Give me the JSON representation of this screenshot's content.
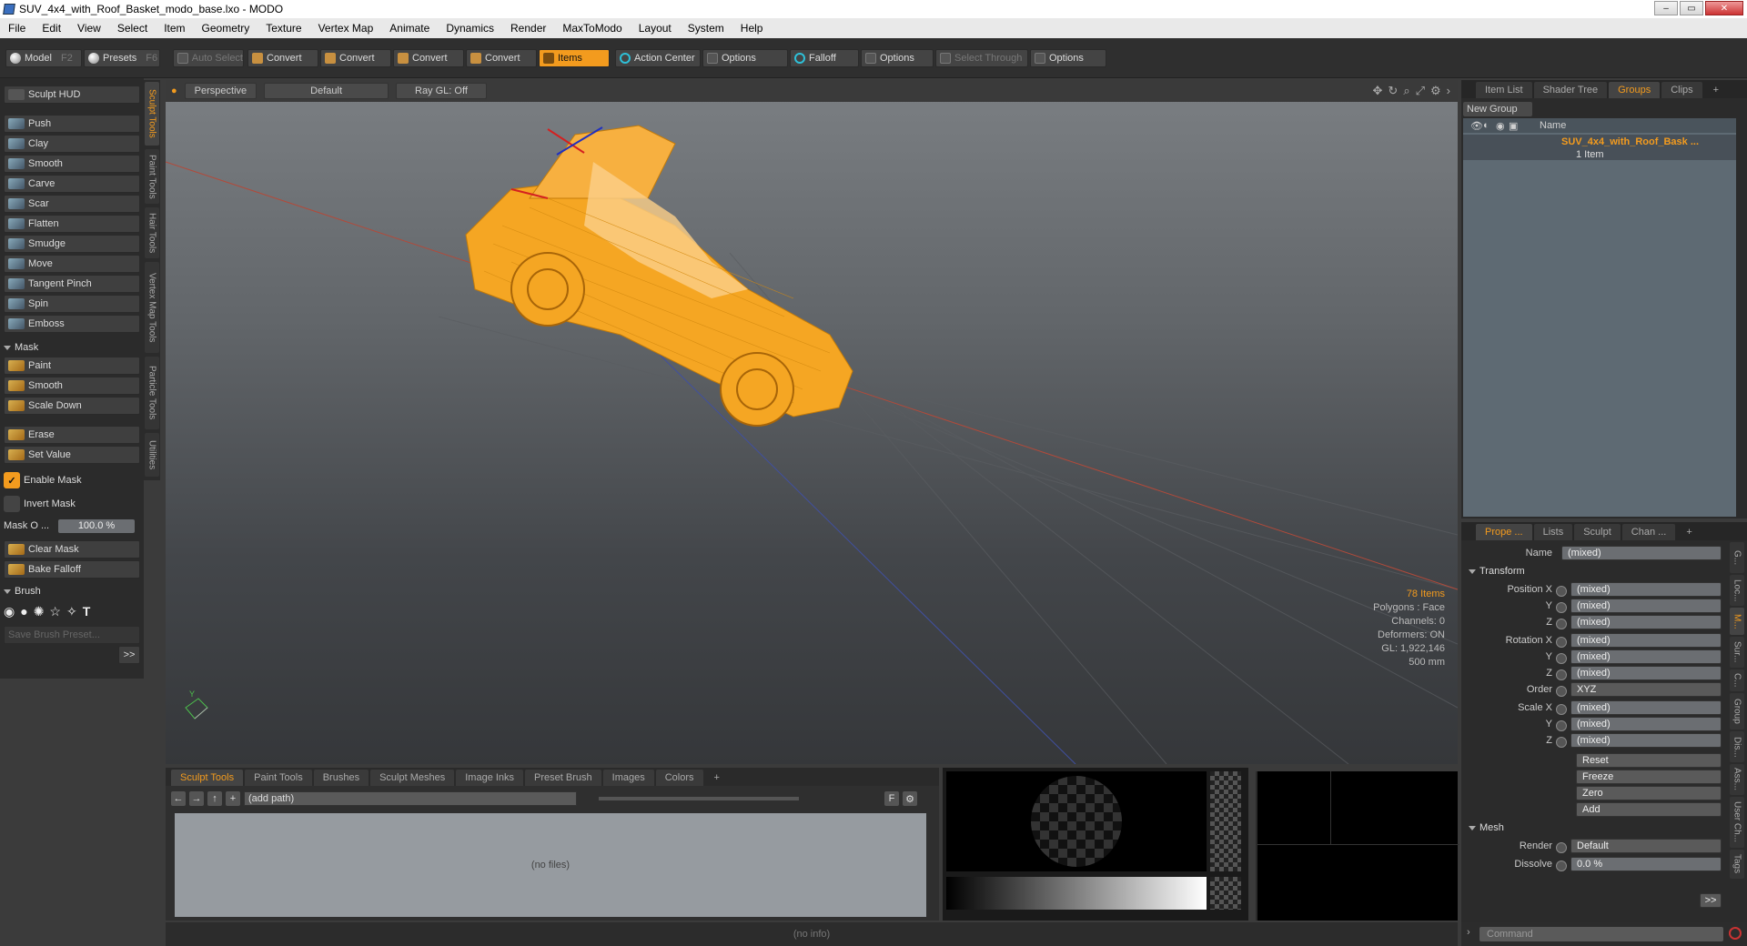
{
  "window": {
    "title": "SUV_4x4_with_Roof_Basket_modo_base.lxo - MODO",
    "buttons": [
      "–",
      "▭",
      "✕"
    ]
  },
  "menu": [
    "File",
    "Edit",
    "View",
    "Select",
    "Item",
    "Geometry",
    "Texture",
    "Vertex Map",
    "Animate",
    "Dynamics",
    "Render",
    "MaxToModo",
    "Layout",
    "System",
    "Help"
  ],
  "toolbar": {
    "model": "Model",
    "model_key": "F2",
    "presets": "Presets",
    "presets_key": "F6",
    "auto_select": "Auto Select",
    "convert": "Convert",
    "items": "Items",
    "action_center": "Action Center",
    "options": "Options",
    "falloff": "Falloff",
    "select_through": "Select Through"
  },
  "left": {
    "sculpt_hud": "Sculpt HUD",
    "tools": [
      "Push",
      "Clay",
      "Smooth",
      "Carve",
      "Scar",
      "Flatten",
      "Smudge",
      "Move",
      "Tangent Pinch",
      "Spin",
      "Emboss"
    ],
    "mask_header": "Mask",
    "mask_tools": [
      "Paint",
      "Smooth",
      "Scale Down"
    ],
    "erase": "Erase",
    "set_value": "Set Value",
    "enable_mask": "Enable Mask",
    "invert_mask": "Invert Mask",
    "mask_opacity_label": "Mask O ...",
    "mask_opacity_value": "100.0 %",
    "clear_mask": "Clear Mask",
    "bake_falloff": "Bake Falloff",
    "brush_header": "Brush",
    "save_brush": "Save Brush Preset...",
    "more": ">>"
  },
  "vtabs": [
    "Sculpt Tools",
    "Paint Tools",
    "Hair Tools",
    "Vertex Map Tools",
    "Particle Tools",
    "Utilities"
  ],
  "viewport": {
    "view": "Perspective",
    "shading": "Default",
    "raygl": "Ray GL: Off",
    "stats": {
      "items": "78 Items",
      "polygons": "Polygons : Face",
      "channels": "Channels: 0",
      "deformers": "Deformers: ON",
      "gl": "GL: 1,922,146",
      "scale": "500 mm"
    },
    "axis_y": "Y"
  },
  "bottom": {
    "tabs": [
      "Sculpt Tools",
      "Paint Tools",
      "Brushes",
      "Sculpt Meshes",
      "Image Inks",
      "Preset Brush",
      "Images",
      "Colors",
      "+"
    ],
    "path": "(add path)",
    "nofiles": "(no files)",
    "f": "F"
  },
  "status": "(no info)",
  "groups": {
    "tabs": [
      "Item List",
      "Shader Tree",
      "Groups",
      "Clips",
      "+"
    ],
    "new_group": "New Group",
    "name_col": "Name",
    "item_name": "SUV_4x4_with_Roof_Bask ...",
    "item_count": "1 Item"
  },
  "props": {
    "tabs": [
      "Prope ...",
      "Lists",
      "Sculpt",
      "Chan ...",
      "+"
    ],
    "name_label": "Name",
    "name_value": "(mixed)",
    "transform": "Transform",
    "position_label": "Position X",
    "rotation_label": "Rotation X",
    "scale_label": "Scale X",
    "y": "Y",
    "z": "Z",
    "mixed": "(mixed)",
    "order_label": "Order",
    "order_value": "XYZ",
    "reset": "Reset",
    "freeze": "Freeze",
    "zero": "Zero",
    "add": "Add",
    "mesh": "Mesh",
    "render_label": "Render",
    "render_value": "Default",
    "dissolve_label": "Dissolve",
    "dissolve_value": "0.0 %",
    "more": ">>"
  },
  "rvtabs": [
    "G...",
    "Loc...",
    "M...",
    "Sur...",
    "C...",
    "Group",
    "Dis...",
    "Ass...",
    "User Ch...",
    "Tags"
  ],
  "command": "Command"
}
